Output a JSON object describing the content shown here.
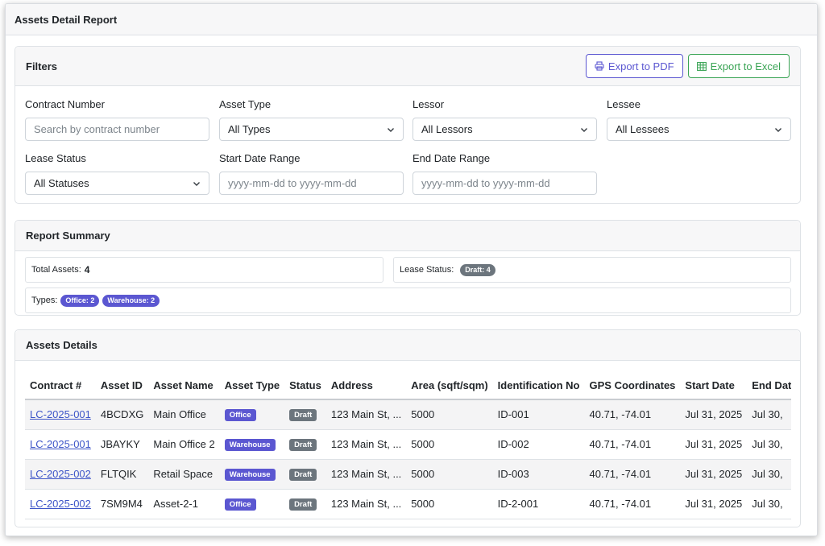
{
  "page_title": "Assets Detail Report",
  "filters": {
    "title": "Filters",
    "export_pdf": "Export to PDF",
    "export_excel": "Export to Excel",
    "contract_number": {
      "label": "Contract Number",
      "placeholder": "Search by contract number"
    },
    "asset_type": {
      "label": "Asset Type",
      "value": "All Types"
    },
    "lessor": {
      "label": "Lessor",
      "value": "All Lessors"
    },
    "lessee": {
      "label": "Lessee",
      "value": "All Lessees"
    },
    "lease_status": {
      "label": "Lease Status",
      "value": "All Statuses"
    },
    "start_date": {
      "label": "Start Date Range",
      "placeholder": "yyyy-mm-dd to yyyy-mm-dd"
    },
    "end_date": {
      "label": "End Date Range",
      "placeholder": "yyyy-mm-dd to yyyy-mm-dd"
    }
  },
  "summary": {
    "title": "Report Summary",
    "total_assets_label": "Total Assets:",
    "total_assets_value": "4",
    "lease_status_label": "Lease Status:",
    "lease_status_badge": "Draft: 4",
    "types_label": "Types:",
    "type_badges": [
      "Office: 2",
      "Warehouse: 2"
    ]
  },
  "details": {
    "title": "Assets Details",
    "columns": [
      "Contract #",
      "Asset ID",
      "Asset Name",
      "Asset Type",
      "Status",
      "Address",
      "Area (sqft/sqm)",
      "Identification No",
      "GPS Coordinates",
      "Start Date",
      "End Date"
    ],
    "rows": [
      [
        "LC-2025-001",
        "4BCDXG",
        "Main Office",
        "Office",
        "Draft",
        "123 Main St, ...",
        "5000",
        "ID-001",
        "40.71, -74.01",
        "Jul 31, 2025",
        "Jul 30,"
      ],
      [
        "LC-2025-001",
        "JBAYKY",
        "Main Office 2",
        "Warehouse",
        "Draft",
        "123 Main St, ...",
        "5000",
        "ID-002",
        "40.71, -74.01",
        "Jul 31, 2025",
        "Jul 30,"
      ],
      [
        "LC-2025-002",
        "FLTQIK",
        "Retail Space",
        "Warehouse",
        "Draft",
        "123 Main St, ...",
        "5000",
        "ID-003",
        "40.71, -74.01",
        "Jul 31, 2025",
        "Jul 30,"
      ],
      [
        "LC-2025-002",
        "7SM9M4",
        "Asset-2-1",
        "Office",
        "Draft",
        "123 Main St, ...",
        "5000",
        "ID-2-001",
        "40.71, -74.01",
        "Jul 31, 2025",
        "Jul 30,"
      ]
    ]
  },
  "colors": {
    "accent": "#5b57d1",
    "excel_green": "#3aa455",
    "badge_gray": "#6c757d",
    "link": "#3d55c8"
  }
}
